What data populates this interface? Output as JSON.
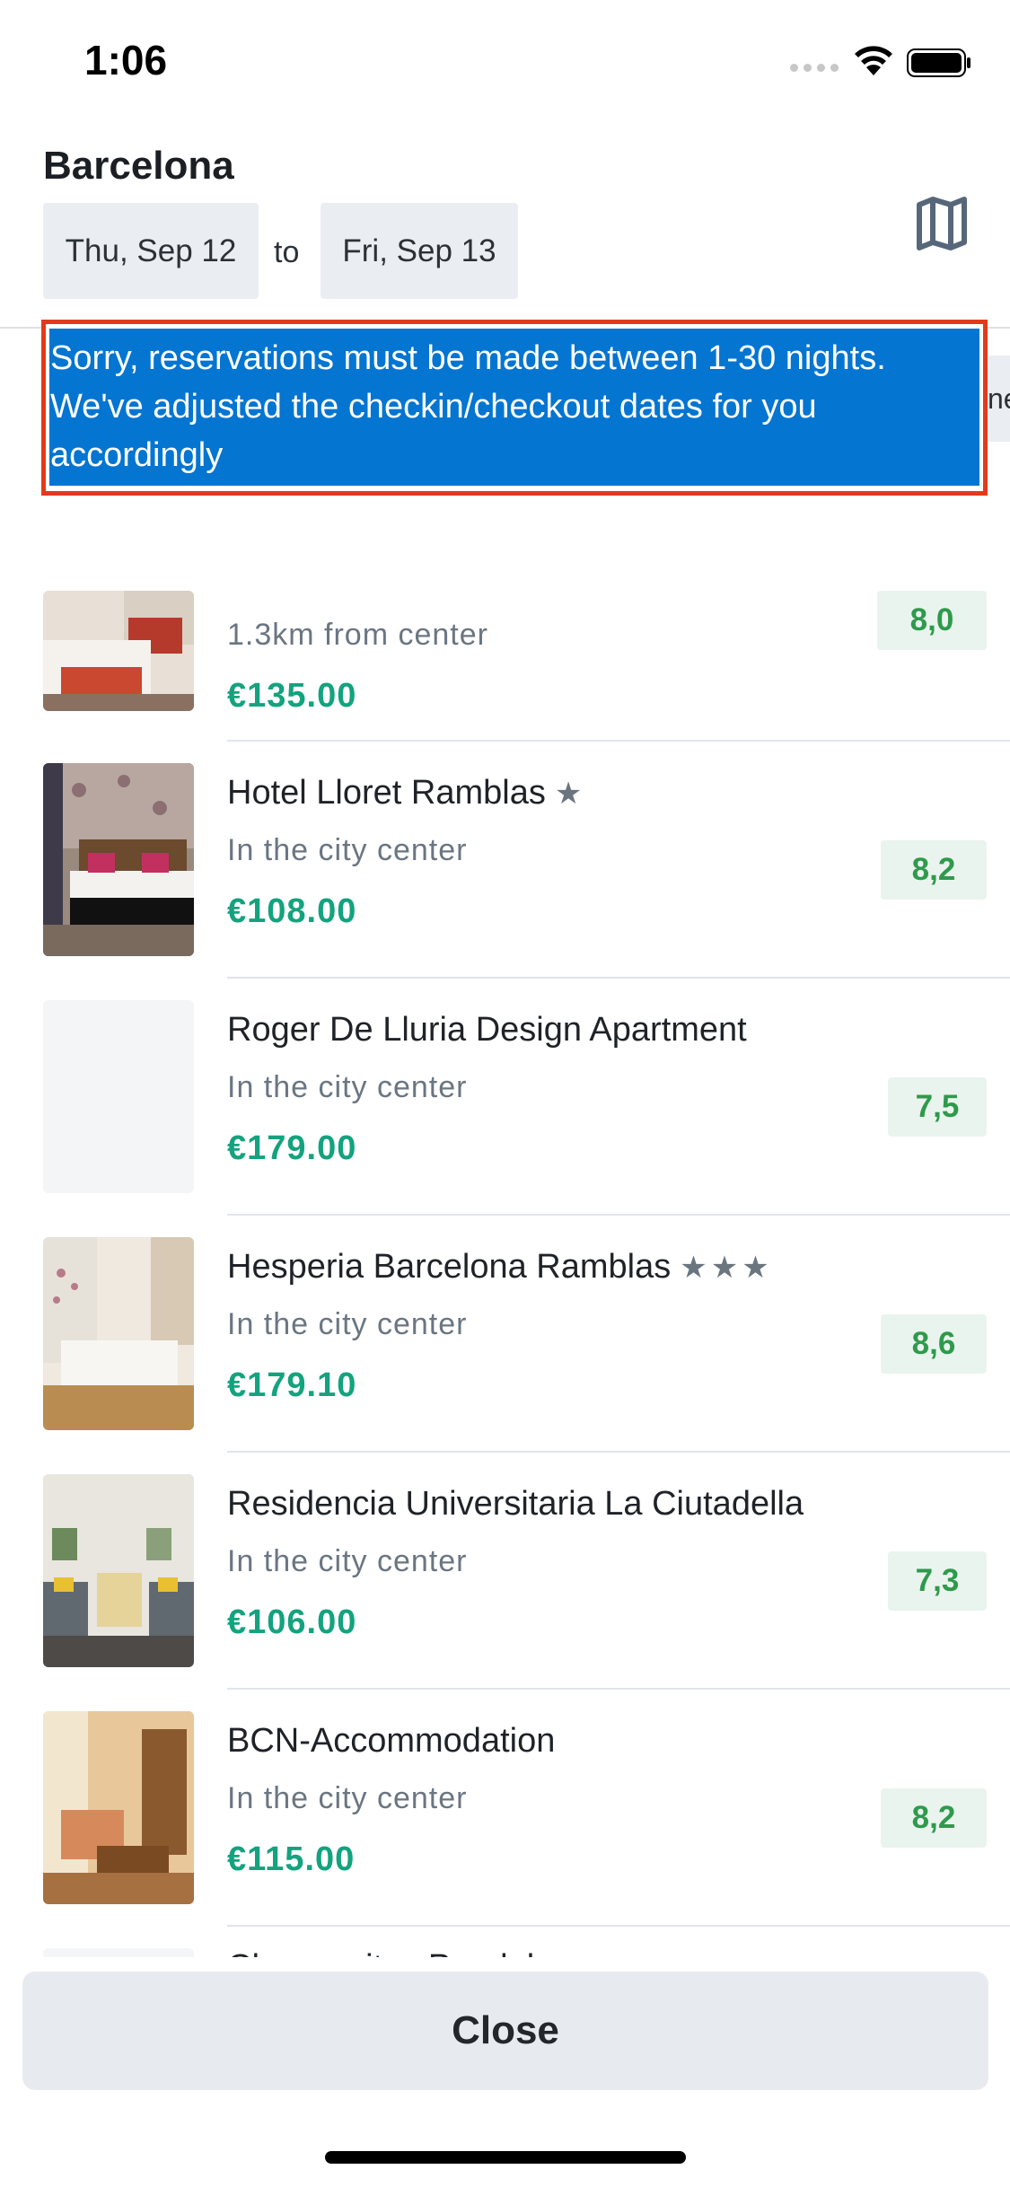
{
  "status_bar": {
    "time": "1:06"
  },
  "header": {
    "city": "Barcelona",
    "checkin": "Thu, Sep 12",
    "to_label": "to",
    "checkout": "Fri, Sep 13",
    "map_icon": "map-icon"
  },
  "alert": {
    "message": "Sorry, reservations must be made between 1-30 nights. We've adjusted the checkin/checkout dates for you accordingly",
    "border_color": "#e5391d",
    "background_color": "#0475d1"
  },
  "peek_chip": "ne",
  "hotels": [
    {
      "name": "",
      "stars": "",
      "location": "1.3km from center",
      "price": "€135.00",
      "rating": "8,0"
    },
    {
      "name": "Hotel Lloret Ramblas",
      "stars": "★",
      "location": "In the city center",
      "price": "€108.00",
      "rating": "8,2"
    },
    {
      "name": "Roger De Lluria Design Apartment",
      "stars": "",
      "location": "In the city center",
      "price": "€179.00",
      "rating": "7,5"
    },
    {
      "name": "Hesperia Barcelona Ramblas",
      "stars": "★★★",
      "location": "In the city center",
      "price": "€179.10",
      "rating": "8,6"
    },
    {
      "name": "Residencia Universitaria La Ciutadella",
      "stars": "",
      "location": "In the city center",
      "price": "€106.00",
      "rating": "7,3"
    },
    {
      "name": "BCN-Accommodation",
      "stars": "",
      "location": "In the city center",
      "price": "€115.00",
      "rating": "8,2"
    }
  ],
  "peek_hotel": "Charmsuites Paralel",
  "close_button": "Close",
  "colors": {
    "price": "#13a37e",
    "rating_text": "#2e9a4c",
    "rating_bg": "#eaf4ee"
  }
}
